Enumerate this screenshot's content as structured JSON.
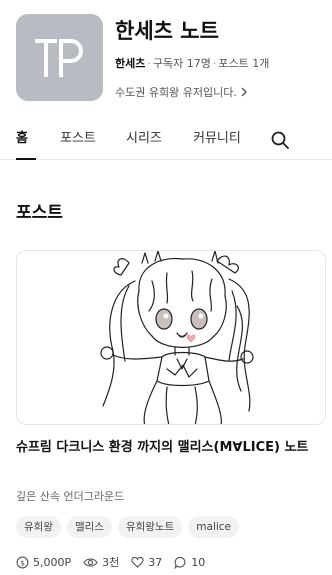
{
  "channel": {
    "title": "한세츠 노트",
    "name": "한세츠",
    "subscribers": "구독자 17명",
    "posts": "포스트 1개",
    "description": "수도권 유희왕 유저입니다."
  },
  "tabs": [
    {
      "label": "홈",
      "active": true
    },
    {
      "label": "포스트",
      "active": false
    },
    {
      "label": "시리즈",
      "active": false
    },
    {
      "label": "커뮤니티",
      "active": false
    }
  ],
  "section": {
    "title": "포스트"
  },
  "post": {
    "title": "슈프림 다크니스 환경 까지의 맬리스(M∀LICE) 노트",
    "subtitle": "깊은 산속 언더그라운드",
    "tags": [
      "유희왕",
      "맬리스",
      "유희왕노트",
      "malice"
    ],
    "stats": {
      "price": "5,000P",
      "views": "3천",
      "likes": "37",
      "comments": "10"
    }
  },
  "colors": {
    "accent": "#111111",
    "logo_bg": "#b8bcc2",
    "tag_bg": "#f1f2f4"
  }
}
